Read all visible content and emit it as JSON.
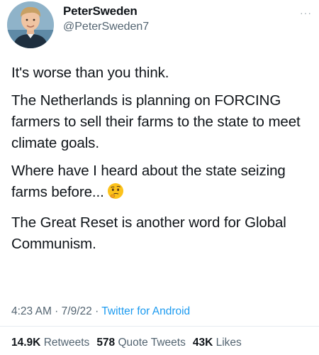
{
  "user": {
    "name": "PeterSweden",
    "handle": "@PeterSweden7"
  },
  "menu": {
    "icon": "more-options-icon",
    "glyph": "···"
  },
  "tweet": {
    "paragraphs": [
      "It's worse than you think.",
      "The Netherlands is planning on FORCING farmers to sell their farms to the state to meet climate goals.",
      "Where have I heard about the state seizing farms before...",
      "The Great Reset is another word for Global Communism."
    ],
    "emoji": "thinking-face-icon"
  },
  "meta": {
    "time": "4:23 AM",
    "separator1": " · ",
    "date": "7/9/22",
    "separator2": " · ",
    "source": "Twitter for Android"
  },
  "stats": {
    "retweets_count": "14.9K",
    "retweets_label": "Retweets",
    "quotes_count": "578",
    "quotes_label": "Quote Tweets",
    "likes_count": "43K",
    "likes_label": "Likes"
  },
  "colors": {
    "link": "#1d9bf0",
    "secondary_text": "#536471",
    "primary_text": "#0f1419"
  }
}
